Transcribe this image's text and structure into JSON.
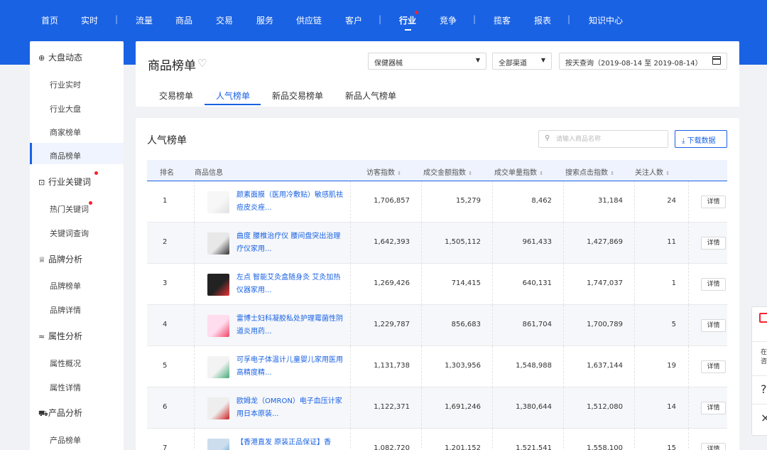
{
  "nav": {
    "items": [
      "首页",
      "实时",
      "流量",
      "商品",
      "交易",
      "服务",
      "供应链",
      "客户",
      "行业",
      "竞争",
      "揽客",
      "报表",
      "知识中心"
    ],
    "active": "行业"
  },
  "sidebar": {
    "groups": [
      {
        "label": "大盘动态",
        "items": [
          "行业实时",
          "行业大盘",
          "商家榜单",
          "商品榜单"
        ]
      },
      {
        "label": "行业关键词",
        "items": [
          "热门关键词",
          "关键词查询"
        ]
      },
      {
        "label": "品牌分析",
        "items": [
          "品牌榜单",
          "品牌详情"
        ]
      },
      {
        "label": "属性分析",
        "items": [
          "属性概况",
          "属性详情"
        ]
      },
      {
        "label": "产品分析",
        "items": [
          "产品榜单"
        ]
      }
    ],
    "active_item": "商品榜单"
  },
  "header": {
    "title": "商品榜单",
    "category_select": "保健器械",
    "channel_select": "全部渠道",
    "date_range": "按天查询（2019-08-14 至 2019-08-14）",
    "tabs": [
      "交易榜单",
      "人气榜单",
      "新品交易榜单",
      "新品人气榜单"
    ],
    "active_tab": "人气榜单"
  },
  "list": {
    "title": "人气榜单",
    "search_placeholder": "请输入商品名称",
    "download_label": "下载数据",
    "columns": [
      "排名",
      "商品信息",
      "访客指数",
      "成交金额指数",
      "成交单量指数",
      "搜索点击指数",
      "关注人数",
      ""
    ],
    "detail_label": "详情",
    "rows": [
      {
        "rank": "1",
        "name": "颜素面膜（医用冷敷贴）敏感肌祛痘皮炎痤...",
        "visitors": "1,706,857",
        "amount": "15,279",
        "orders": "8,462",
        "search": "31,184",
        "follow": "24"
      },
      {
        "rank": "2",
        "name": "曲度 腰椎治疗仪 腰间盘突出治理疗仪家用...",
        "visitors": "1,642,393",
        "amount": "1,505,112",
        "orders": "961,433",
        "search": "1,427,869",
        "follow": "11"
      },
      {
        "rank": "3",
        "name": "左点 智能艾灸盒随身灸 艾灸加热仪器家用...",
        "visitors": "1,269,426",
        "amount": "714,415",
        "orders": "640,131",
        "search": "1,747,037",
        "follow": "1"
      },
      {
        "rank": "4",
        "name": "雷博士妇科凝胶私处护理霉菌性阴道炎用药...",
        "visitors": "1,229,787",
        "amount": "856,683",
        "orders": "861,704",
        "search": "1,700,789",
        "follow": "5"
      },
      {
        "rank": "5",
        "name": "可孚电子体温计儿童婴儿家用医用高精度精...",
        "visitors": "1,131,738",
        "amount": "1,303,956",
        "orders": "1,548,988",
        "search": "1,637,144",
        "follow": "19"
      },
      {
        "rank": "6",
        "name": "欧姆龙（OMRON）电子血压计家用日本原装...",
        "visitors": "1,122,371",
        "amount": "1,691,246",
        "orders": "1,380,644",
        "search": "1,512,080",
        "follow": "14"
      },
      {
        "rank": "7",
        "name": "【香港直发 原装正品保证】香",
        "visitors": "1,082,720",
        "amount": "1,201,152",
        "orders": "1,521,541",
        "search": "1,558,100",
        "follow": "15"
      }
    ]
  },
  "float_panel": {
    "text": "在\n咨"
  },
  "colors": {
    "brand": "#1a62e4",
    "red_dot": "#f5222d"
  }
}
